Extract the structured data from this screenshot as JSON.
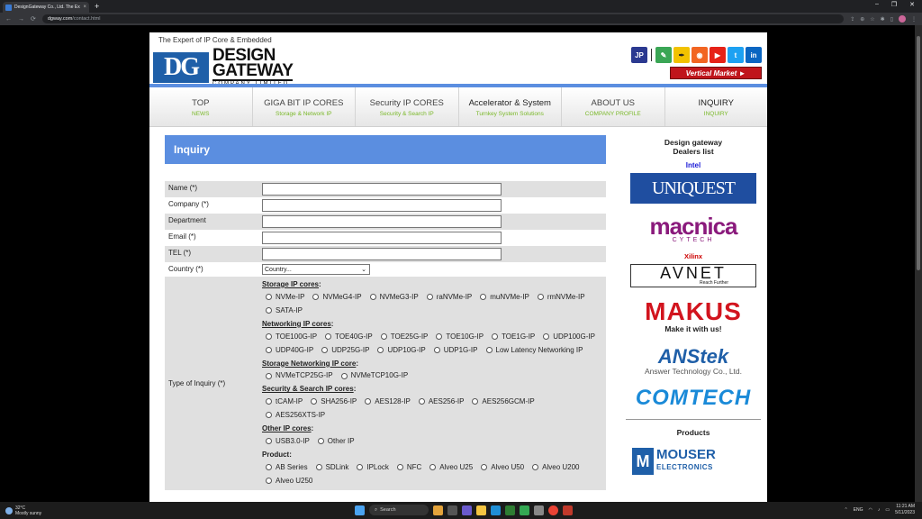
{
  "browser": {
    "tab_title": "DesignGateway Co., Ltd. The Exp",
    "tab_close": "×",
    "new_tab": "+",
    "url_host": "dgway.com",
    "url_path": "/contact.html",
    "nav_back": "←",
    "nav_forward": "→",
    "nav_reload": "⟳",
    "win_min": "–",
    "win_max": "❐",
    "win_close": "✕"
  },
  "header": {
    "tagline": "The Expert of IP Core & Embedded",
    "logo_mark": "DG",
    "logo_line1": "DESIGN",
    "logo_line2": "GATEWAY",
    "logo_sub": "COMPANY LIMITED",
    "lang_jp": "JP",
    "vertical_market": "Vertical Market ►"
  },
  "menu": [
    {
      "title": "TOP",
      "sub": "NEWS"
    },
    {
      "title": "GIGA BIT IP CORES",
      "sub": "Storage & Network IP"
    },
    {
      "title": "Security IP CORES",
      "sub": "Security & Search IP"
    },
    {
      "title": "Accelerator & System",
      "sub": "Turnkey System Solutions"
    },
    {
      "title": "ABOUT US",
      "sub": "COMPANY PROFILE"
    },
    {
      "title": "INQUIRY",
      "sub": "INQUIRY"
    }
  ],
  "inquiry": {
    "heading": "Inquiry",
    "fields": {
      "name": "Name (*)",
      "company": "Company (*)",
      "department": "Department",
      "email": "Email (*)",
      "tel": "TEL (*)",
      "country": "Country (*)",
      "country_value": "Country...",
      "type": "Type of Inquiry (*)"
    },
    "groups": {
      "storage": "Storage IP cores",
      "networking": "Networking IP cores",
      "storage_net": "Storage Networking IP core",
      "security": "Security & Search IP cores",
      "other": "Other IP cores",
      "product": "Product:"
    },
    "storage_opts": [
      "NVMe-IP",
      "NVMeG4-IP",
      "NVMeG3-IP",
      "raNVMe-IP",
      "muNVMe-IP",
      "rmNVMe-IP",
      "SATA-IP"
    ],
    "networking_opts": [
      "TOE100G-IP",
      "TOE40G-IP",
      "TOE25G-IP",
      "TOE10G-IP",
      "TOE1G-IP",
      "UDP100G-IP",
      "UDP40G-IP",
      "UDP25G-IP",
      "UDP10G-IP",
      "UDP1G-IP",
      "Low Latency Networking IP"
    ],
    "storage_net_opts": [
      "NVMeTCP25G-IP",
      "NVMeTCP10G-IP"
    ],
    "security_opts": [
      "tCAM-IP",
      "SHA256-IP",
      "AES128-IP",
      "AES256-IP",
      "AES256GCM-IP",
      "AES256XTS-IP"
    ],
    "other_opts": [
      "USB3.0-IP",
      "Other IP"
    ],
    "product_opts": [
      "AB Series",
      "SDLink",
      "IPLock",
      "NFC",
      "Alveo U25",
      "Alveo U50",
      "Alveo U200",
      "Alveo U250"
    ]
  },
  "sidebar": {
    "dealers_line1": "Design gateway",
    "dealers_line2": "Dealers list",
    "intel": "Intel",
    "uniquest": "UNIQUEST",
    "macnica": "macnica",
    "macnica_sub": "CYTECH",
    "xilinx": "Xilinx",
    "avnet": "AVNET",
    "avnet_sub": "Reach Further",
    "makus": "MAKUS",
    "makus_sub": "Make it with us!",
    "anstek": "ANStek",
    "anstek_sub": "Answer Technology Co., Ltd.",
    "comtech": "COMTECH",
    "products": "Products",
    "mouser": "MOUSER",
    "mouser_sub": "ELECTRONICS"
  },
  "taskbar": {
    "temp": "32°C",
    "weather": "Mostly sunny",
    "search": "Search",
    "lang": "ENG",
    "time": "11:21 AM",
    "date": "5/11/2023"
  },
  "colors": {
    "accent_blue": "#5b8ee0",
    "menu_sub_green": "#7ab829",
    "vertical_market_red": "#c0151b"
  }
}
